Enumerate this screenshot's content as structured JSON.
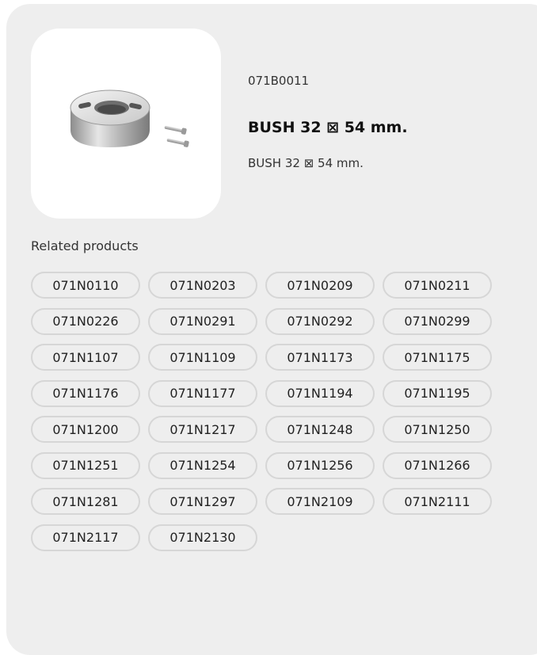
{
  "product": {
    "code": "071B0011",
    "title": "BUSH 32 ⊠ 54 mm.",
    "description": "BUSH 32 ⊠ 54 mm."
  },
  "related": {
    "heading": "Related products",
    "items": [
      "071N0110",
      "071N0203",
      "071N0209",
      "071N0211",
      "071N0226",
      "071N0291",
      "071N0292",
      "071N0299",
      "071N1107",
      "071N1109",
      "071N1173",
      "071N1175",
      "071N1176",
      "071N1177",
      "071N1194",
      "071N1195",
      "071N1200",
      "071N1217",
      "071N1248",
      "071N1250",
      "071N1251",
      "071N1254",
      "071N1256",
      "071N1266",
      "071N1281",
      "071N1297",
      "071N2109",
      "071N2111",
      "071N2117",
      "071N2130"
    ]
  }
}
